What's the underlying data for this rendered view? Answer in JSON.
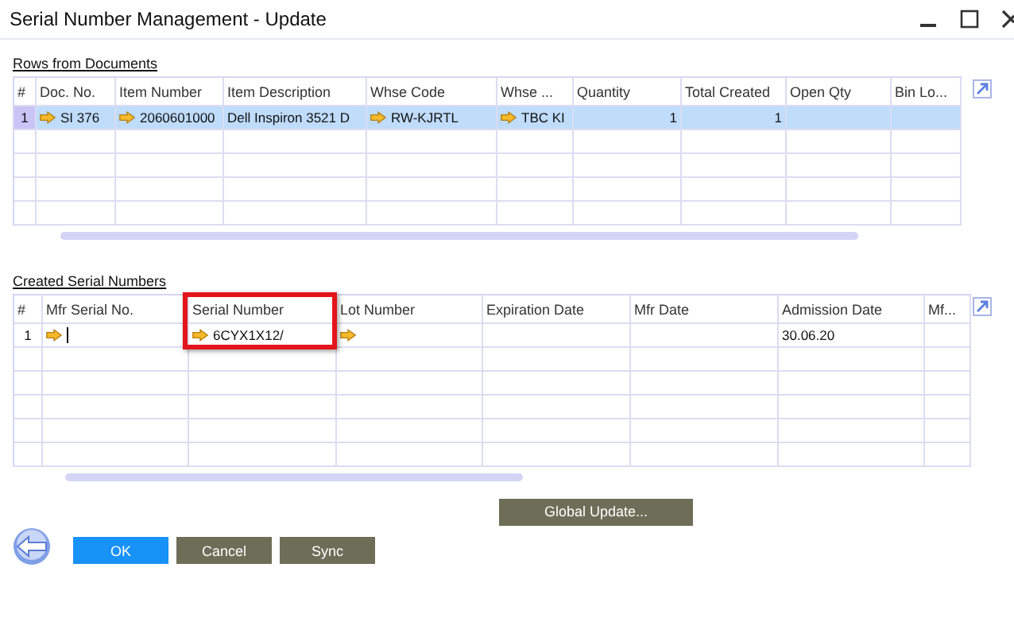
{
  "window": {
    "title": "Serial Number Management - Update"
  },
  "documents": {
    "title": "Rows from Documents",
    "columns": [
      {
        "label": "#"
      },
      {
        "label": "Doc. No."
      },
      {
        "label": "Item Number"
      },
      {
        "label": "Item Description"
      },
      {
        "label": "Whse Code"
      },
      {
        "label": "Whse ..."
      },
      {
        "label": "Quantity"
      },
      {
        "label": "Total Created"
      },
      {
        "label": "Open Qty"
      },
      {
        "label": "Bin Lo..."
      }
    ],
    "rows": [
      {
        "selected": true,
        "cells": [
          {
            "text": "1",
            "kind": "index"
          },
          {
            "text": "SI 376",
            "link": true
          },
          {
            "text": "2060601000",
            "link": true
          },
          {
            "text": "Dell Inspiron 3521 D"
          },
          {
            "text": "RW-KJRTL",
            "link": true
          },
          {
            "text": "TBC KI",
            "link": true
          },
          {
            "text": "1",
            "kind": "number"
          },
          {
            "text": "1",
            "kind": "number"
          },
          {},
          {}
        ]
      }
    ]
  },
  "serials": {
    "title": "Created Serial Numbers",
    "columns": [
      {
        "label": "#"
      },
      {
        "label": "Mfr Serial No."
      },
      {
        "label": "Serial Number",
        "highlighted": true
      },
      {
        "label": "Lot Number"
      },
      {
        "label": "Expiration Date"
      },
      {
        "label": "Mfr Date"
      },
      {
        "label": "Admission Date"
      },
      {
        "label": "Mf..."
      }
    ],
    "rows": [
      {
        "selected": false,
        "cells": [
          {
            "text": "1",
            "kind": "index"
          },
          {
            "link": true,
            "focused": true
          },
          {
            "text": "6CYX1X12/",
            "link": true
          },
          {
            "link": true
          },
          {},
          {},
          {
            "text": "30.06.20"
          },
          {}
        ]
      }
    ]
  },
  "buttons": [
    {
      "label": "Global Update...",
      "kind": "secondary"
    }
  ],
  "footer_buttons": [
    {
      "label": "OK",
      "kind": "primary"
    },
    {
      "label": "Cancel",
      "kind": "secondary"
    },
    {
      "label": "Sync",
      "kind": "secondary"
    }
  ]
}
